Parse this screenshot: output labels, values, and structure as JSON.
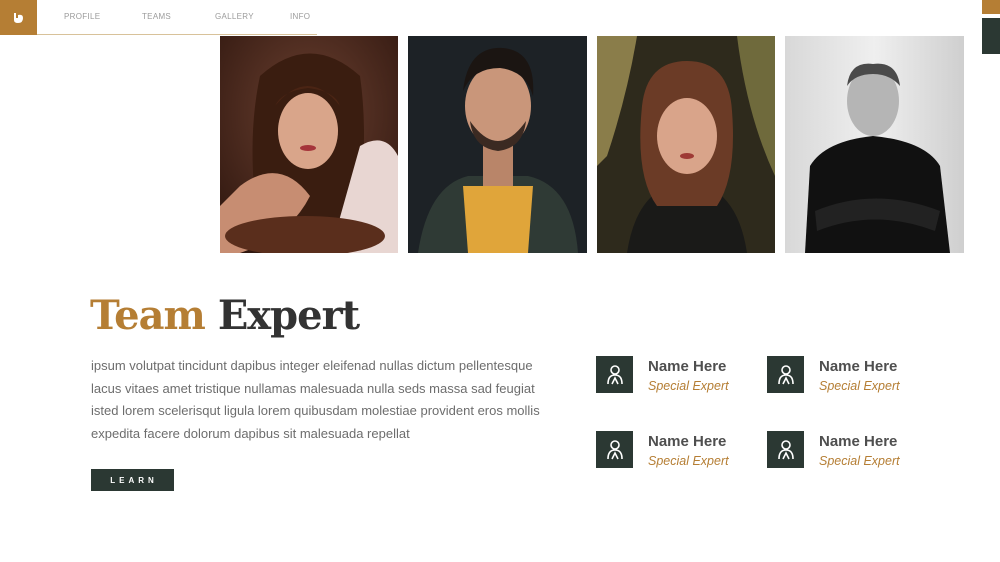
{
  "nav": {
    "items": [
      "PROFILE",
      "TEAMS",
      "GALLERY",
      "INFO"
    ]
  },
  "icons": {
    "logo": "leaf-logo-icon",
    "member": "person-icon"
  },
  "colors": {
    "accent": "#b57e34",
    "dark": "#2b3833"
  },
  "title": {
    "highlight": "Team",
    "rest": "Expert"
  },
  "body_text": "ipsum volutpat tincidunt dapibus integer eleifenad nullas dictum pellentesque lacus vitaes amet tristique nullamas malesuada nulla seds massa sad feugiat isted lorem scelerisqut ligula lorem quibusdam molestiae provident eros mollis expedita facere dolorum dapibus sit malesuada repellat",
  "learn_button": "LEARN",
  "members": [
    {
      "name": "Name Here",
      "role": "Special Expert"
    },
    {
      "name": "Name Here",
      "role": "Special Expert"
    },
    {
      "name": "Name Here",
      "role": "Special Expert"
    },
    {
      "name": "Name Here",
      "role": "Special Expert"
    }
  ]
}
